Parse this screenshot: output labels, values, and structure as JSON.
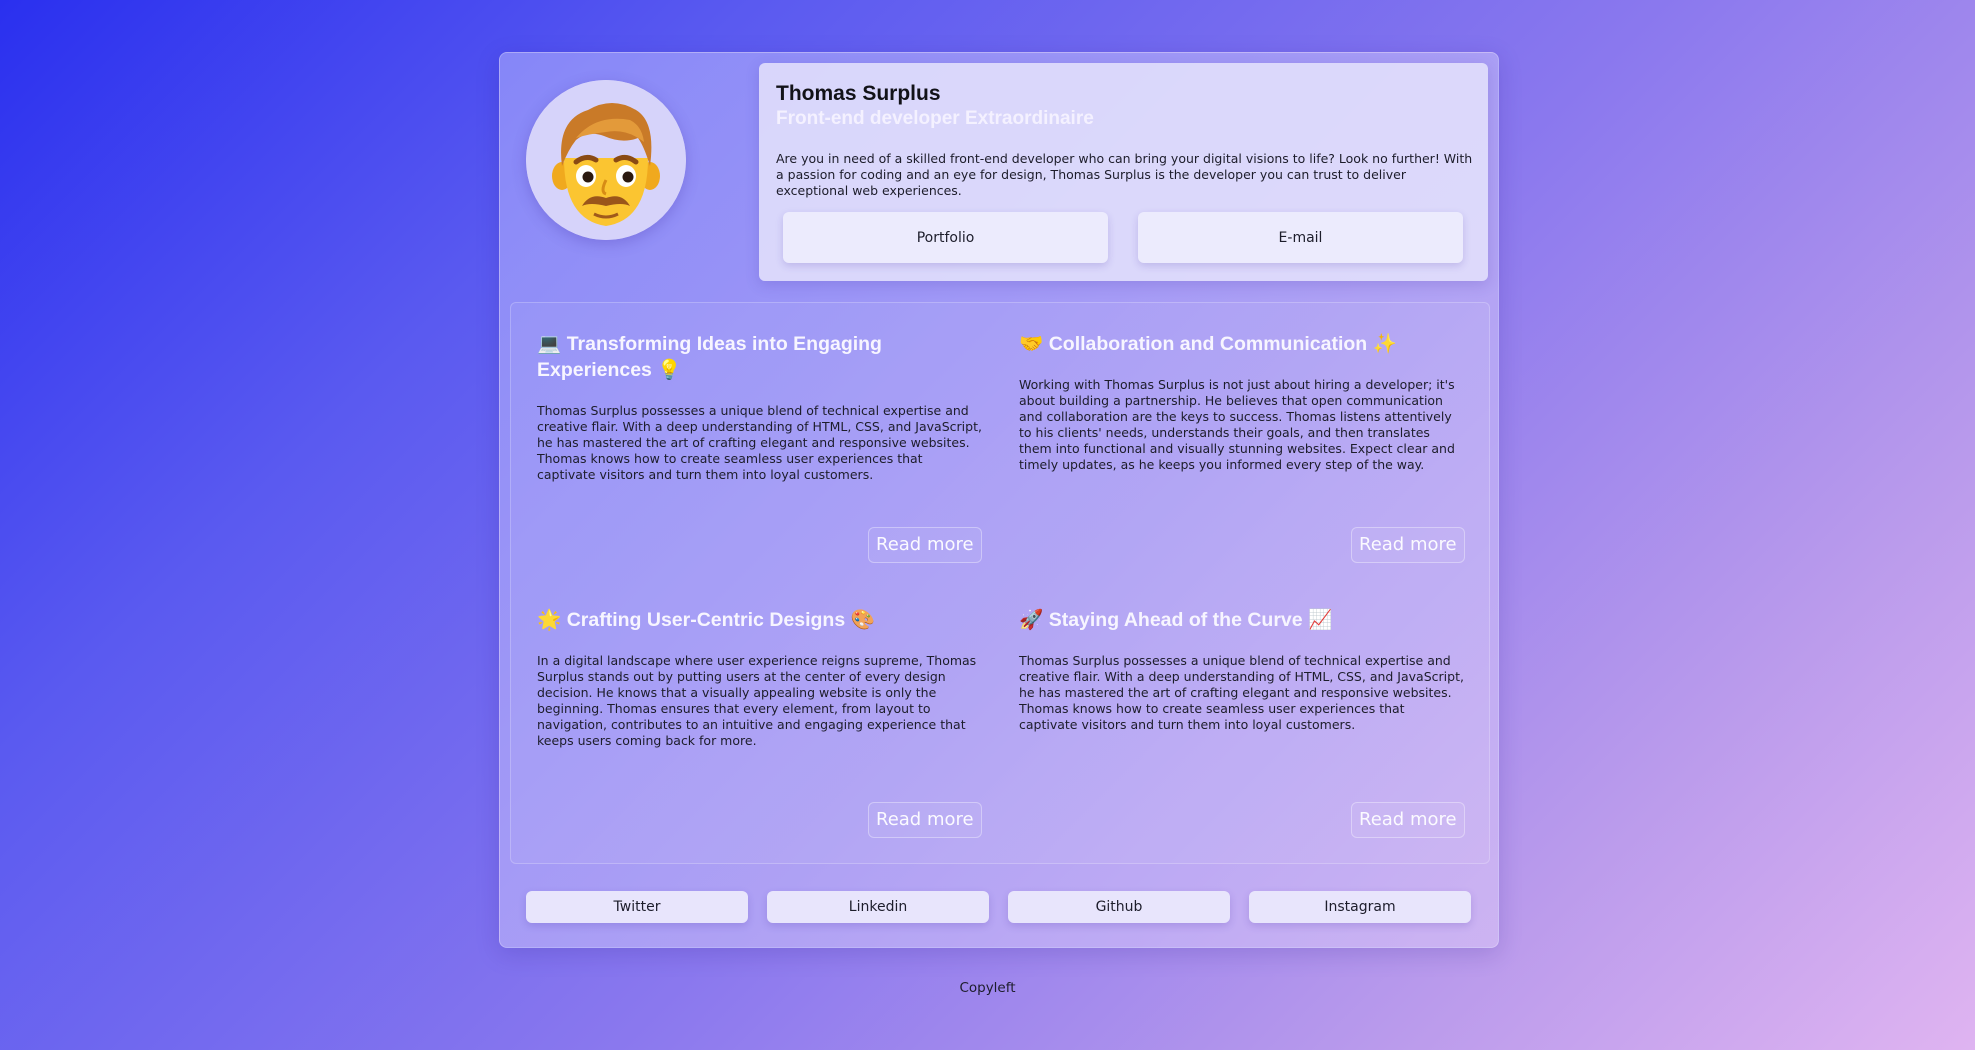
{
  "profile": {
    "name": "Thomas Surplus",
    "role": "Front-end developer Extraordinaire",
    "description": "Are you in need of a skilled front-end developer who can bring your digital visions to life? Look no further! With a passion for coding and an eye for design, Thomas Surplus is the developer you can trust to deliver exceptional web experiences.",
    "avatar_icon": "man-with-mustache-emoji-icon",
    "buttons": {
      "portfolio": "Portfolio",
      "email": "E-mail"
    }
  },
  "articles": [
    {
      "title": "💻 Transforming Ideas into Engaging Experiences 💡",
      "body": "Thomas Surplus possesses a unique blend of technical expertise and creative flair. With a deep understanding of HTML, CSS, and JavaScript, he has mastered the art of crafting elegant and responsive websites. Thomas knows how to create seamless user experiences that captivate visitors and turn them into loyal customers.",
      "read_more": "Read more"
    },
    {
      "title": "🤝 Collaboration and Communication ✨",
      "body": "Working with Thomas Surplus is not just about hiring a developer; it's about building a partnership. He believes that open communication and collaboration are the keys to success. Thomas listens attentively to his clients' needs, understands their goals, and then translates them into functional and visually stunning websites. Expect clear and timely updates, as he keeps you informed every step of the way.",
      "read_more": "Read more"
    },
    {
      "title": "🌟 Crafting User-Centric Designs 🎨",
      "body": "In a digital landscape where user experience reigns supreme, Thomas Surplus stands out by putting users at the center of every design decision. He knows that a visually appealing website is only the beginning. Thomas ensures that every element, from layout to navigation, contributes to an intuitive and engaging experience that keeps users coming back for more.",
      "read_more": "Read more"
    },
    {
      "title": "🚀 Staying Ahead of the Curve 📈",
      "body": "Thomas Surplus possesses a unique blend of technical expertise and creative flair. With a deep understanding of HTML, CSS, and JavaScript, he has mastered the art of crafting elegant and responsive websites. Thomas knows how to create seamless user experiences that captivate visitors and turn them into loyal customers.",
      "read_more": "Read more"
    }
  ],
  "social": [
    "Twitter",
    "Linkedin",
    "Github",
    "Instagram"
  ],
  "footer": "Copyleft",
  "colors": {
    "background_start": "#2a30ef",
    "background_end": "#dfb4f1",
    "role_text": "#f4f1ff",
    "button_bg": "#ecebfd"
  }
}
